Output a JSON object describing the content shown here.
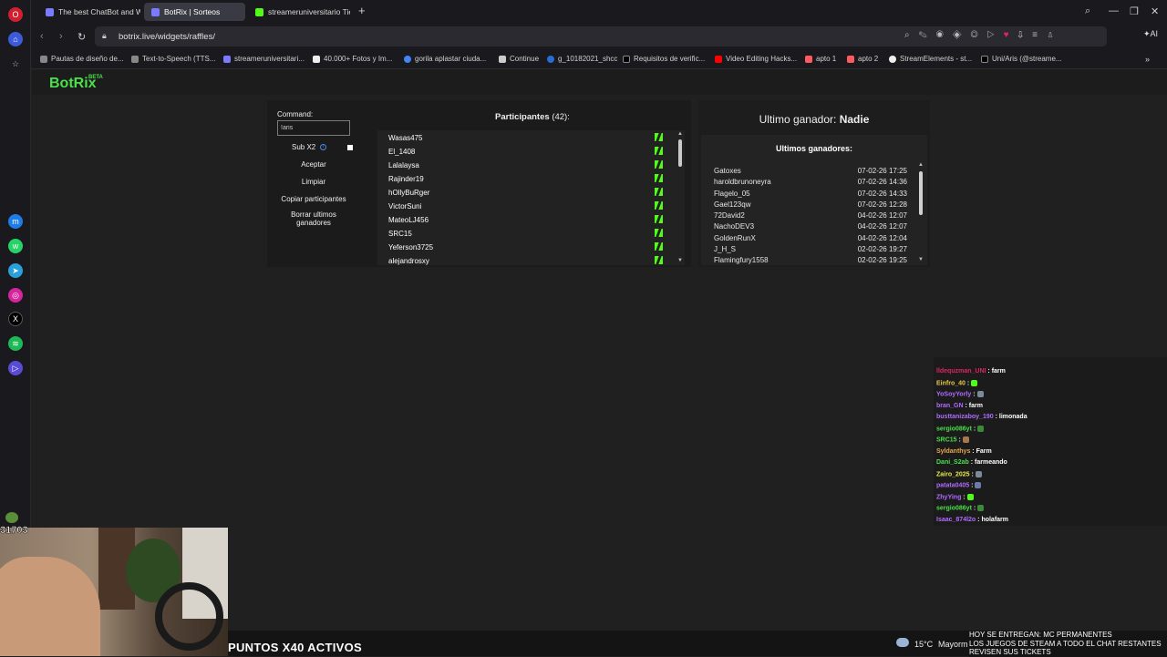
{
  "browser": {
    "tabs": [
      {
        "label": "The best ChatBot and Wi"
      },
      {
        "label": "BotRix | Sorteos"
      },
      {
        "label": "streameruniversitario Tien"
      }
    ],
    "url": "botrix.live/widgets/raffles/",
    "bookmarks": [
      {
        "label": "Pautas de diseño de...",
        "color": "#d6d6d6"
      },
      {
        "label": "Text-to-Speech (TTS...",
        "color": "#e6e6e6"
      },
      {
        "label": "streameruniversitari...",
        "color": "#7b7bff"
      },
      {
        "label": "40.000+ Fotos y Im...",
        "color": "#ffffff"
      },
      {
        "label": "gorila aplastar ciuda...",
        "color": "#4285f4"
      },
      {
        "label": "Continue",
        "color": "#e0e0e0"
      },
      {
        "label": "g_10182021_shcc",
        "color": "#2a6cd6"
      },
      {
        "label": "Requisitos de verific...",
        "color": "#ffffff"
      },
      {
        "label": "Video Editing Hacks...",
        "color": "#ff0000"
      },
      {
        "label": "apto 1",
        "color": "#ff5a5f"
      },
      {
        "label": "apto 2",
        "color": "#ff5a5f"
      },
      {
        "label": "StreamElements - st...",
        "color": "#ffffff"
      },
      {
        "label": "Uni/Aris (@streame...",
        "color": "#ffffff"
      }
    ]
  },
  "site": {
    "logo": "BotRix",
    "beta": "BETA"
  },
  "raffle": {
    "command_label": "Command:",
    "command_value": "!aris",
    "sub_label": "Sub X2",
    "info_glyph": "i",
    "accept_label": "Aceptar",
    "clear_label": "Limpiar",
    "copy_label": "Copiar participantes",
    "delete_label_1": "Borrar ultimos",
    "delete_label_2": "ganadores",
    "participants_title": "Participantes",
    "participants_count": "(42):",
    "participants": [
      "Wasas475",
      "El_1408",
      "Lalalaysa",
      "Rajinder19",
      "hOllyBuRger",
      "VictorSuni",
      "MateoLJ456",
      "SRC15",
      "Yeferson3725",
      "alejandrosxy"
    ]
  },
  "winners": {
    "last_winner_label": "Ultimo ganador:",
    "last_winner_name": "Nadie",
    "title": "Ultimos ganadores:",
    "rows": [
      {
        "name": "Gatoxes",
        "date": "07-02-26 17:25"
      },
      {
        "name": "haroldbrunoneyra",
        "date": "07-02-26 14:36"
      },
      {
        "name": "Flagelo_05",
        "date": "07-02-26 14:33"
      },
      {
        "name": "Gael123qw",
        "date": "07-02-26 12:28"
      },
      {
        "name": "72David2",
        "date": "04-02-26 12:07"
      },
      {
        "name": "NachoDEV3",
        "date": "04-02-26 12:07"
      },
      {
        "name": "GoldenRunX",
        "date": "04-02-26 12:04"
      },
      {
        "name": "J_H_S",
        "date": "02-02-26 19:27"
      },
      {
        "name": "Flamingfury1558",
        "date": "02-02-26 19:25"
      }
    ]
  },
  "chat": [
    {
      "user": "lldequzman_UNI",
      "msg": "farm",
      "color": "#e0245e"
    },
    {
      "user": "Einfro_40",
      "msg": "",
      "color": "#e8c84a",
      "emote": "#53fc18"
    },
    {
      "user": "YoSoyYorly",
      "msg": "",
      "color": "#b06bff",
      "emote": "#7b8a9a"
    },
    {
      "user": "bran_GN",
      "msg": "farm",
      "color": "#b06bff"
    },
    {
      "user": "busttanizaboy_190",
      "msg": "limonada",
      "color": "#b06bff"
    },
    {
      "user": "sergio086yt",
      "msg": "",
      "color": "#4be04b",
      "emote": "#3a8a3a"
    },
    {
      "user": "SRC15",
      "msg": "",
      "color": "#4be04b",
      "emote": "#a57a4a"
    },
    {
      "user": "Syldanthys",
      "msg": "Farm",
      "color": "#e8a84a"
    },
    {
      "user": "Dani_S2ab",
      "msg": "farmeando",
      "color": "#4be04b"
    },
    {
      "user": "Zairo_2025",
      "msg": "",
      "color": "#e8e84a",
      "emote": "#7b8a9a"
    },
    {
      "user": "patata0405",
      "msg": "",
      "color": "#b06bff",
      "emote": "#6a7aaa"
    },
    {
      "user": "ZhyYing",
      "msg": "",
      "color": "#b06bff",
      "emote": "#53fc18"
    },
    {
      "user": "sergio086yt",
      "msg": "",
      "color": "#4be04b",
      "emote": "#3a8a3a"
    },
    {
      "user": "Isaac_874l2o",
      "msg": "holafarm",
      "color": "#b06bff"
    }
  ],
  "stream": {
    "viewer_count": "31703",
    "puntos": "PUNTOS X40 ACTIVOS",
    "temp": "15°C",
    "weather_text": "Mayorm",
    "ticker_1": "HOY SE ENTREGAN: MC PERMANENTES",
    "ticker_2": "LOS JUEGOS DE STEAM A TODO EL CHAT RESTANTES",
    "ticker_3": "REVISEN SUS TICKETS"
  }
}
